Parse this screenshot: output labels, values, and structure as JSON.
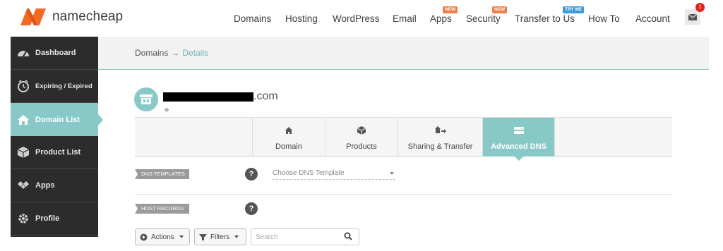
{
  "brand": {
    "name": "namecheap",
    "accent": "#f26b21",
    "teal": "#88c9c7"
  },
  "nav": {
    "items": [
      {
        "label": "Domains"
      },
      {
        "label": "Hosting"
      },
      {
        "label": "WordPress"
      },
      {
        "label": "Email"
      },
      {
        "label": "Apps",
        "badge": "NEW"
      },
      {
        "label": "Security",
        "badge": "NEW"
      },
      {
        "label": "Transfer to Us",
        "badge": "TRY ME"
      },
      {
        "label": "How To"
      },
      {
        "label": "Account"
      }
    ],
    "notifications": {
      "icon": "mail-icon",
      "count": "!"
    }
  },
  "sidebar": {
    "items": [
      {
        "label": "Dashboard",
        "icon": "gauge-icon"
      },
      {
        "label": "Expiring / Expired",
        "icon": "clock-icon"
      },
      {
        "label": "Domain List",
        "icon": "home-icon",
        "active": true
      },
      {
        "label": "Product List",
        "icon": "box-icon"
      },
      {
        "label": "Apps",
        "icon": "apps-icon"
      },
      {
        "label": "Profile",
        "icon": "gear-icon"
      }
    ]
  },
  "breadcrumb": {
    "root": "Domains",
    "separator": "→",
    "current": "Details"
  },
  "domain": {
    "suffix": ".com"
  },
  "tabs": [
    {
      "label": "Domain",
      "icon": "home-icon"
    },
    {
      "label": "Products",
      "icon": "box-icon"
    },
    {
      "label": "Sharing & Transfer",
      "icon": "share-icon"
    },
    {
      "label": "Advanced DNS",
      "icon": "server-icon",
      "active": true
    }
  ],
  "dns_templates": {
    "label": "DNS TEMPLATES",
    "select_placeholder": "Choose DNS Template",
    "help": "?"
  },
  "host_records": {
    "label": "HOST RECORDS",
    "help": "?"
  },
  "toolbar": {
    "actions_label": "Actions",
    "filters_label": "Filters",
    "search_placeholder": "Search"
  }
}
